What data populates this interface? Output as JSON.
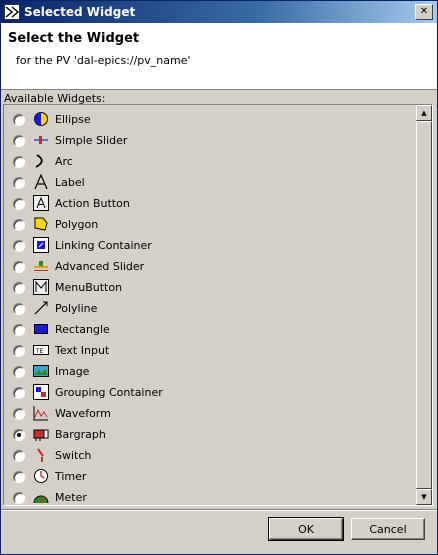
{
  "window": {
    "title": "Selected Widget",
    "close_glyph": "✕"
  },
  "banner": {
    "heading": "Select the Widget",
    "subtitle": "for the PV 'dal-epics://pv_name'"
  },
  "list": {
    "label": "Available Widgets:",
    "selected": "Bargraph",
    "items": [
      {
        "label": "Ellipse",
        "icon": "ellipse-icon"
      },
      {
        "label": "Simple Slider",
        "icon": "simple-slider-icon"
      },
      {
        "label": "Arc",
        "icon": "arc-icon"
      },
      {
        "label": "Label",
        "icon": "label-icon"
      },
      {
        "label": "Action Button",
        "icon": "action-button-icon"
      },
      {
        "label": "Polygon",
        "icon": "polygon-icon"
      },
      {
        "label": "Linking Container",
        "icon": "linking-container-icon"
      },
      {
        "label": "Advanced Slider",
        "icon": "advanced-slider-icon"
      },
      {
        "label": "MenuButton",
        "icon": "menu-button-icon"
      },
      {
        "label": "Polyline",
        "icon": "polyline-icon"
      },
      {
        "label": "Rectangle",
        "icon": "rectangle-icon"
      },
      {
        "label": "Text Input",
        "icon": "text-input-icon"
      },
      {
        "label": "Image",
        "icon": "image-icon"
      },
      {
        "label": "Grouping Container",
        "icon": "grouping-container-icon"
      },
      {
        "label": "Waveform",
        "icon": "waveform-icon"
      },
      {
        "label": "Bargraph",
        "icon": "bargraph-icon"
      },
      {
        "label": "Switch",
        "icon": "switch-icon"
      },
      {
        "label": "Timer",
        "icon": "timer-icon"
      },
      {
        "label": "Meter",
        "icon": "meter-icon"
      }
    ]
  },
  "buttons": {
    "ok": "OK",
    "cancel": "Cancel"
  },
  "colors": {
    "title_bar": "#0a246a",
    "dialog_bg": "#d4d0c8"
  }
}
